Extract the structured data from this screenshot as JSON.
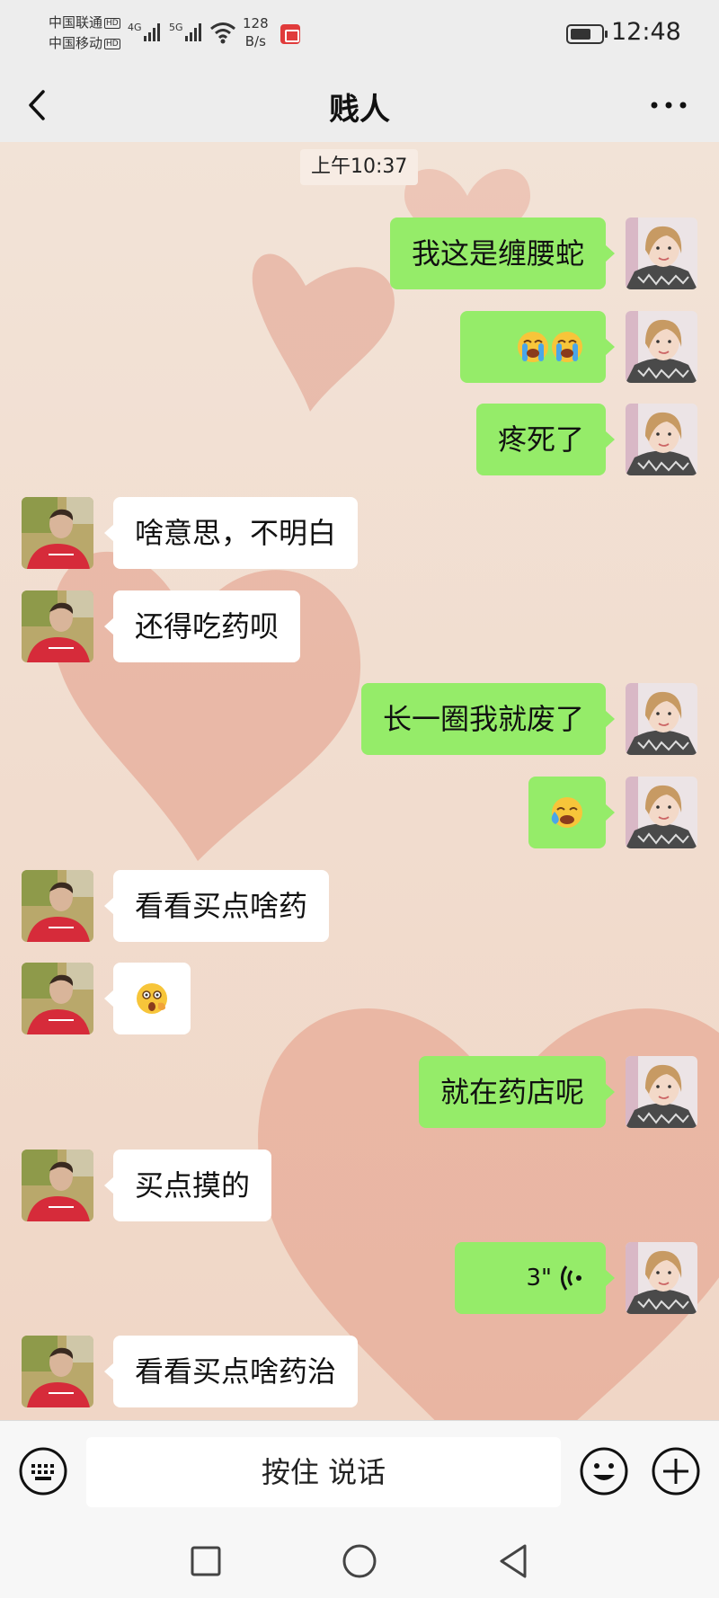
{
  "status_bar": {
    "carrier1": "中国联通",
    "carrier2": "中国移动",
    "hd": "HD",
    "net1": "4G",
    "net2": "5G",
    "speed_value": "128",
    "speed_unit": "B/s",
    "time": "12:48"
  },
  "header": {
    "title": "贱人",
    "back_icon": "chevron-left-icon",
    "more_icon": "more-dots-icon"
  },
  "chat": {
    "timestamp": "上午10:37",
    "messages": [
      {
        "side": "me",
        "type": "text",
        "text": "我这是缠腰蛇"
      },
      {
        "side": "me",
        "type": "emoji",
        "emoji": "loudly-crying-face x3"
      },
      {
        "side": "me",
        "type": "text",
        "text": "疼死了"
      },
      {
        "side": "other",
        "type": "text",
        "text": "啥意思，不明白"
      },
      {
        "side": "other",
        "type": "text",
        "text": "还得吃药呗"
      },
      {
        "side": "me",
        "type": "text",
        "text": "长一圈我就废了"
      },
      {
        "side": "me",
        "type": "emoji",
        "emoji": "crying-face"
      },
      {
        "side": "other",
        "type": "text",
        "text": "看看买点啥药"
      },
      {
        "side": "other",
        "type": "emoji",
        "emoji": "shocked-face"
      },
      {
        "side": "me",
        "type": "text",
        "text": "就在药店呢"
      },
      {
        "side": "other",
        "type": "text",
        "text": "买点摸的"
      },
      {
        "side": "me",
        "type": "voice",
        "duration": "3\""
      },
      {
        "side": "other",
        "type": "text",
        "text": "看看买点啥药治"
      }
    ]
  },
  "input_bar": {
    "hold_to_talk": "按住 说话",
    "keyboard_icon": "keyboard-icon",
    "emoji_icon": "smiley-icon",
    "plus_icon": "plus-icon"
  },
  "colors": {
    "my_bubble": "#95ec69",
    "other_bubble": "#ffffff",
    "chat_background": "#f3dccd",
    "heart": "#e9a490"
  }
}
